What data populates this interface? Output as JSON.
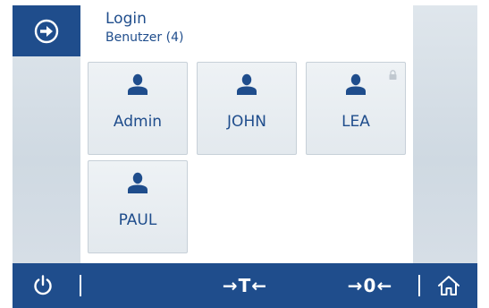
{
  "header": {
    "title": "Login",
    "subtitle": "Benutzer (4)"
  },
  "users": [
    {
      "name": "Admin",
      "locked": false
    },
    {
      "name": "JOHN",
      "locked": false
    },
    {
      "name": "LEA",
      "locked": true
    },
    {
      "name": "PAUL",
      "locked": false
    }
  ],
  "bottom_bar": {
    "tare_label": "→T←",
    "zero_label": "→0←"
  },
  "colors": {
    "primary": "#1f4d8c",
    "tile_bg": "#e8edf1",
    "lock": "#c0c8cf"
  }
}
